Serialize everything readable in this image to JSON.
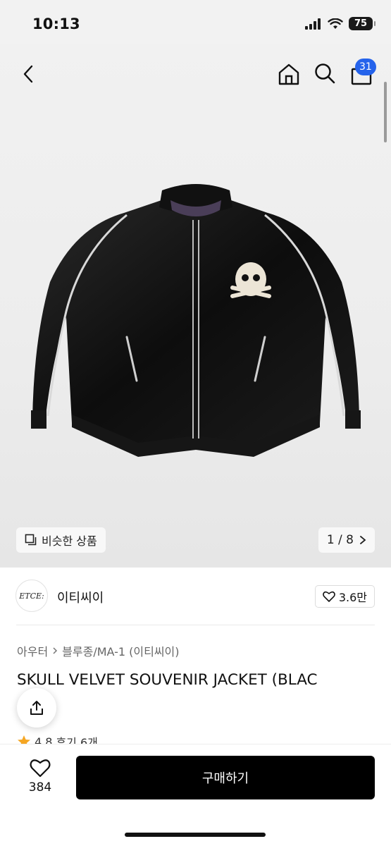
{
  "status_bar": {
    "time": "10:13",
    "battery": "75"
  },
  "nav": {
    "cart_count": "31"
  },
  "gallery": {
    "similar_label": "비슷한 상품",
    "page_indicator": "1 / 8"
  },
  "brand": {
    "logo_text": "ETCE:",
    "name": "이티씨이",
    "likes": "3.6만"
  },
  "breadcrumb": {
    "category": "아우터",
    "subcategory": "블루종/MA-1 (이티씨이)"
  },
  "product": {
    "title": "SKULL VELVET SOUVENIR JACKET (BLAC",
    "rating": "4.8",
    "reviews": "후기 6개"
  },
  "bottom_bar": {
    "wish_count": "384",
    "buy_label": "구매하기"
  },
  "colors": {
    "accent_badge": "#2563eb",
    "buy_button": "#000000",
    "star": "#f5a623"
  }
}
